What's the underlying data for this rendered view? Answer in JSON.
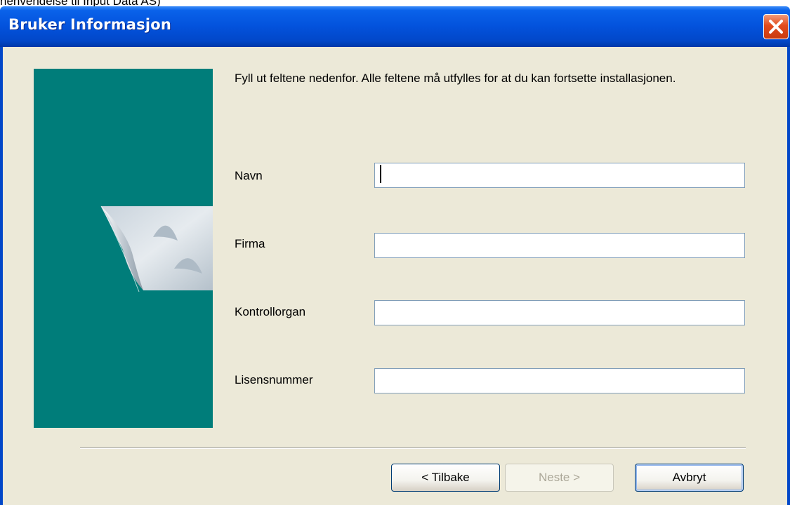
{
  "caption": "henvendelse til Input Data AS)",
  "window": {
    "title": "Bruker Informasjon",
    "close_icon": "close-icon"
  },
  "instruction": "Fyll ut feltene nedenfor. Alle feltene må utfylles for at du kan fortsette installasjonen.",
  "fields": [
    {
      "label": "Navn",
      "value": ""
    },
    {
      "label": "Firma",
      "value": ""
    },
    {
      "label": "Kontrollorgan",
      "value": ""
    },
    {
      "label": "Lisensnummer",
      "value": ""
    }
  ],
  "buttons": {
    "back": "< Tilbake",
    "next": "Neste >",
    "next_disabled": true,
    "cancel": "Avbryt"
  },
  "colors": {
    "titlebar": "#0352dc",
    "panel": "#007d7a",
    "dialog_bg": "#ece9d8",
    "close": "#e24b1d"
  }
}
